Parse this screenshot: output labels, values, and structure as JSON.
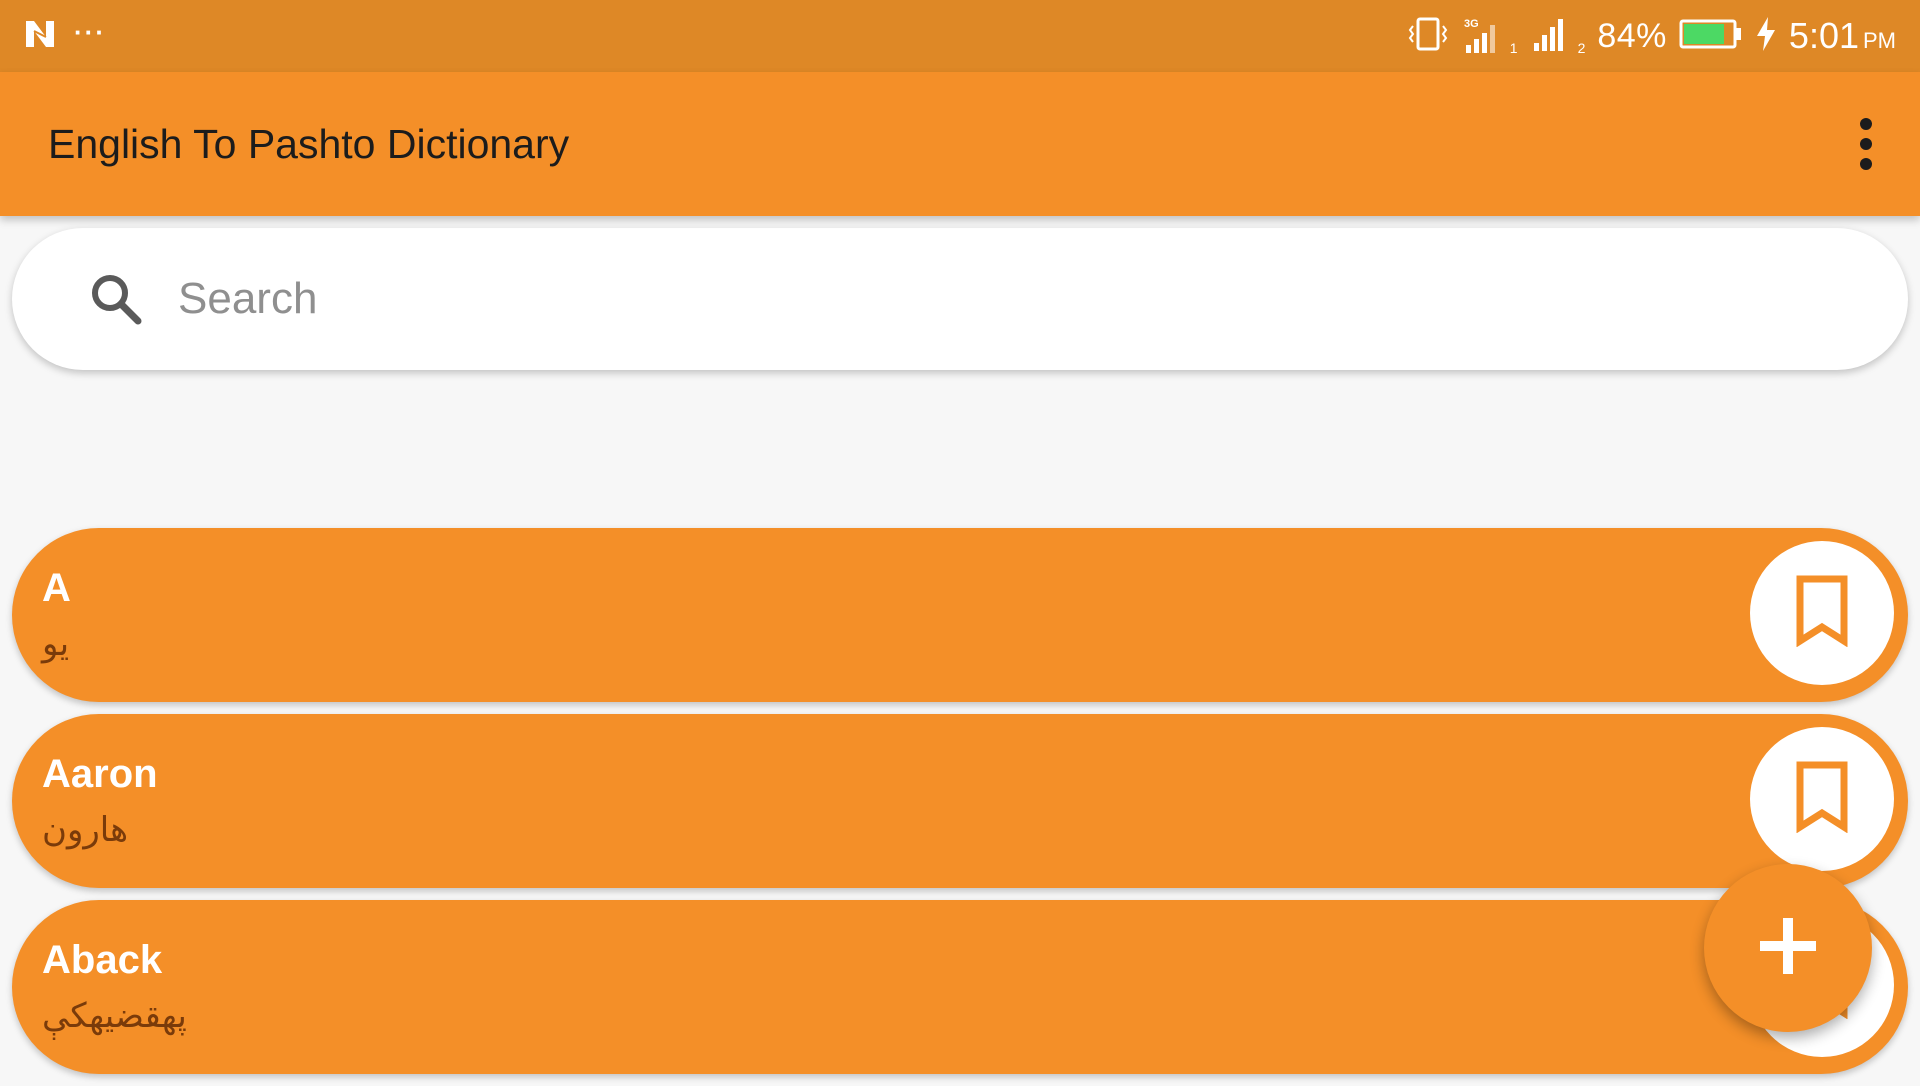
{
  "status_bar": {
    "left_icons": [
      "n-logo-icon",
      "more-notifications-icon"
    ],
    "notification_dots": "···",
    "network_type": "3G",
    "sim1_label": "1",
    "sim2_label": "2",
    "battery_percent": "84%",
    "battery_level": 0.84,
    "time": "5:01",
    "ampm": "PM"
  },
  "app_bar": {
    "title": "English To Pashto Dictionary",
    "menu_icon": "overflow-menu-icon"
  },
  "search": {
    "placeholder": "Search",
    "value": "",
    "icon": "search-icon"
  },
  "words": [
    {
      "english": "A",
      "pashto": "یو"
    },
    {
      "english": "Aaron",
      "pashto": "هارون"
    },
    {
      "english": "Aback",
      "pashto": "پهقضیهکې"
    }
  ],
  "fab": {
    "icon": "plus-icon"
  },
  "colors": {
    "status_bar": "#de8826",
    "primary": "#f48f28",
    "background": "#f7f7f7",
    "pashto_text": "#7a3b0a"
  }
}
